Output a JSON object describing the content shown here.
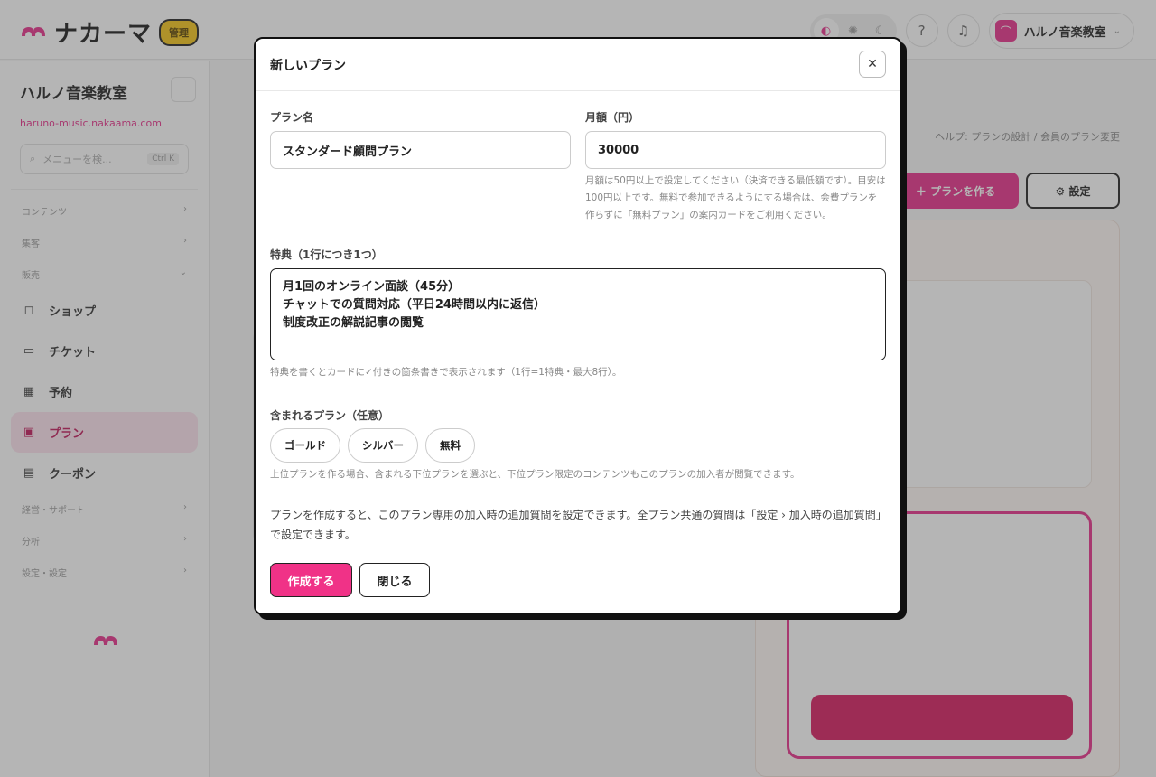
{
  "app": {
    "logo_text": "ナカーマ",
    "logo_badge": "管理"
  },
  "header": {
    "account_name": "ハルノ音楽教室",
    "account_initial": "⌒"
  },
  "sidebar": {
    "title": "ハルノ音楽教室",
    "site_link": "haruno-music.nakaama.com",
    "search_placeholder": "メニューを検...",
    "search_shortcut": "Ctrl K",
    "groups": [
      "コンテンツ",
      "集客",
      "販売"
    ],
    "items": [
      {
        "label": "ショップ",
        "icon": "bag-icon"
      },
      {
        "label": "チケット",
        "icon": "ticket-icon"
      },
      {
        "label": "予約",
        "icon": "calendar-icon"
      },
      {
        "label": "プラン",
        "icon": "plan-icon"
      },
      {
        "label": "クーポン",
        "icon": "coupon-icon"
      }
    ],
    "groups_bottom": [
      "経営・サポート",
      "分析",
      "設定・設定"
    ]
  },
  "main": {
    "breadcrumb": "ヘルプ: プランの設計 / 会員のプラン変更",
    "create_button": "＋ プランを作る",
    "settings_button": "⚙ 設定"
  },
  "modal": {
    "title": "新しいプラン",
    "close_label": "✕",
    "plan_name_label": "プラン名",
    "plan_name_value": "スタンダード顧問プラン",
    "price_label": "月額（円）",
    "price_value": "30000",
    "price_hint": "月額は50円以上で設定してください（決済できる最低額です）。目安は100円以上です。無料で参加できるようにする場合は、会費プランを作らずに「無料プラン」の案内カードをご利用ください。",
    "benefits_label": "特典（1行につき1つ）",
    "benefits_lines": [
      "月1回のオンライン面談（45分）",
      "チャットでの質問対応（平日24時間以内に返信）",
      "制度改正の解説記事の閲覧"
    ],
    "benefits_hint": "特典を書くとカードに✓付きの箇条書きで表示されます（1行=1特典・最大8行）。",
    "included_label": "含まれるプラン（任意）",
    "included_options": [
      "ゴールド",
      "シルバー",
      "無料"
    ],
    "included_hint": "上位プランを作る場合、含まれる下位プランを選ぶと、下位プラン限定のコンテンツもこのプランの加入者が閲覧できます。",
    "note": "プランを作成すると、このプラン専用の加入時の追加質問を設定できます。全プラン共通の質問は「設定 › 加入時の追加質問」で設定できます。",
    "create_button": "作成する",
    "close_button": "閉じる"
  },
  "colors": {
    "accent": "#f03287",
    "overlay": "#464646"
  }
}
